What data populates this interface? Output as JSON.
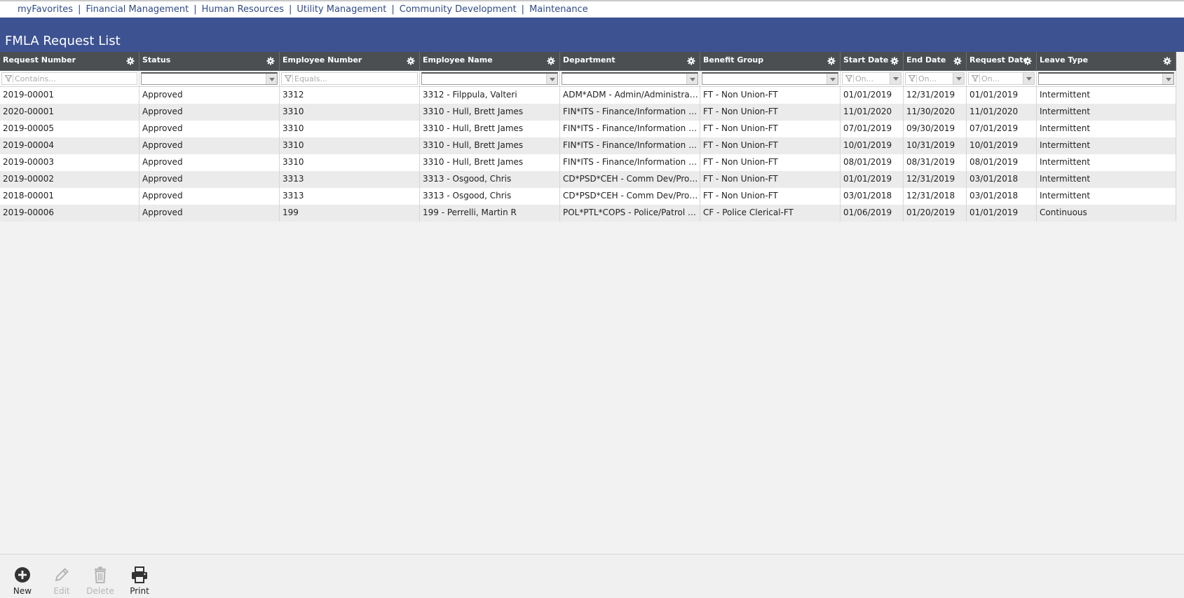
{
  "nav": {
    "links": [
      "myFavorites",
      "Financial Management",
      "Human Resources",
      "Utility Management",
      "Community Development",
      "Maintenance"
    ],
    "separator": "|"
  },
  "page": {
    "title": "FMLA Request List"
  },
  "grid": {
    "columns": [
      {
        "key": "request_number",
        "label": "Request Number",
        "filter": {
          "kind": "text",
          "placeholder": "Contains..."
        }
      },
      {
        "key": "status",
        "label": "Status",
        "filter": {
          "kind": "select",
          "placeholder": ""
        }
      },
      {
        "key": "employee_number",
        "label": "Employee Number",
        "filter": {
          "kind": "text",
          "placeholder": "Equals..."
        }
      },
      {
        "key": "employee_name",
        "label": "Employee Name",
        "filter": {
          "kind": "select",
          "placeholder": ""
        }
      },
      {
        "key": "department",
        "label": "Department",
        "filter": {
          "kind": "select",
          "placeholder": ""
        }
      },
      {
        "key": "benefit_group",
        "label": "Benefit Group",
        "filter": {
          "kind": "select",
          "placeholder": ""
        }
      },
      {
        "key": "start_date",
        "label": "Start Date",
        "filter": {
          "kind": "date",
          "placeholder": "On..."
        }
      },
      {
        "key": "end_date",
        "label": "End Date",
        "filter": {
          "kind": "date",
          "placeholder": "On..."
        }
      },
      {
        "key": "request_date",
        "label": "Request Date",
        "filter": {
          "kind": "date",
          "placeholder": "On..."
        }
      },
      {
        "key": "leave_type",
        "label": "Leave Type",
        "filter": {
          "kind": "select",
          "placeholder": ""
        }
      }
    ],
    "rows": [
      [
        "2019-00001",
        "Approved",
        "3312",
        "3312 - Filppula, Valteri",
        "ADM*ADM - Admin/Administrativ...",
        "FT - Non Union-FT",
        "01/01/2019",
        "12/31/2019",
        "01/01/2019",
        "Intermittent"
      ],
      [
        "2020-00001",
        "Approved",
        "3310",
        "3310 - Hull, Brett James",
        "FIN*ITS - Finance/Information Tec...",
        "FT - Non Union-FT",
        "11/01/2020",
        "11/30/2020",
        "11/01/2020",
        "Intermittent"
      ],
      [
        "2019-00005",
        "Approved",
        "3310",
        "3310 - Hull, Brett James",
        "FIN*ITS - Finance/Information Tec...",
        "FT - Non Union-FT",
        "07/01/2019",
        "09/30/2019",
        "07/01/2019",
        "Intermittent"
      ],
      [
        "2019-00004",
        "Approved",
        "3310",
        "3310 - Hull, Brett James",
        "FIN*ITS - Finance/Information Tec...",
        "FT - Non Union-FT",
        "10/01/2019",
        "10/31/2019",
        "10/01/2019",
        "Intermittent"
      ],
      [
        "2019-00003",
        "Approved",
        "3310",
        "3310 - Hull, Brett James",
        "FIN*ITS - Finance/Information Tec...",
        "FT - Non Union-FT",
        "08/01/2019",
        "08/31/2019",
        "08/01/2019",
        "Intermittent"
      ],
      [
        "2019-00002",
        "Approved",
        "3313",
        "3313 - Osgood, Chris",
        "CD*PSD*CEH - Comm Dev/Proper...",
        "FT - Non Union-FT",
        "01/01/2019",
        "12/31/2019",
        "03/01/2018",
        "Intermittent"
      ],
      [
        "2018-00001",
        "Approved",
        "3313",
        "3313 - Osgood, Chris",
        "CD*PSD*CEH - Comm Dev/Proper...",
        "FT - Non Union-FT",
        "03/01/2018",
        "12/31/2018",
        "03/01/2018",
        "Intermittent"
      ],
      [
        "2019-00006",
        "Approved",
        "199",
        "199 - Perrelli, Martin R",
        "POL*PTL*COPS - Police/Patrol Ser...",
        "CF - Police Clerical-FT",
        "01/06/2019",
        "01/20/2019",
        "01/01/2019",
        "Continuous"
      ]
    ]
  },
  "toolbar": {
    "buttons": [
      {
        "label": "New",
        "icon": "plus-circle-icon",
        "enabled": true
      },
      {
        "label": "Edit",
        "icon": "pencil-icon",
        "enabled": false
      },
      {
        "label": "Delete",
        "icon": "trash-icon",
        "enabled": false
      },
      {
        "label": "Print",
        "icon": "printer-icon",
        "enabled": true
      }
    ]
  },
  "colors": {
    "title_bar": "#3d5291",
    "header_bar": "#4b4f52",
    "nav_link": "#2f4a86",
    "disabled_text": "#b5b5b5"
  }
}
